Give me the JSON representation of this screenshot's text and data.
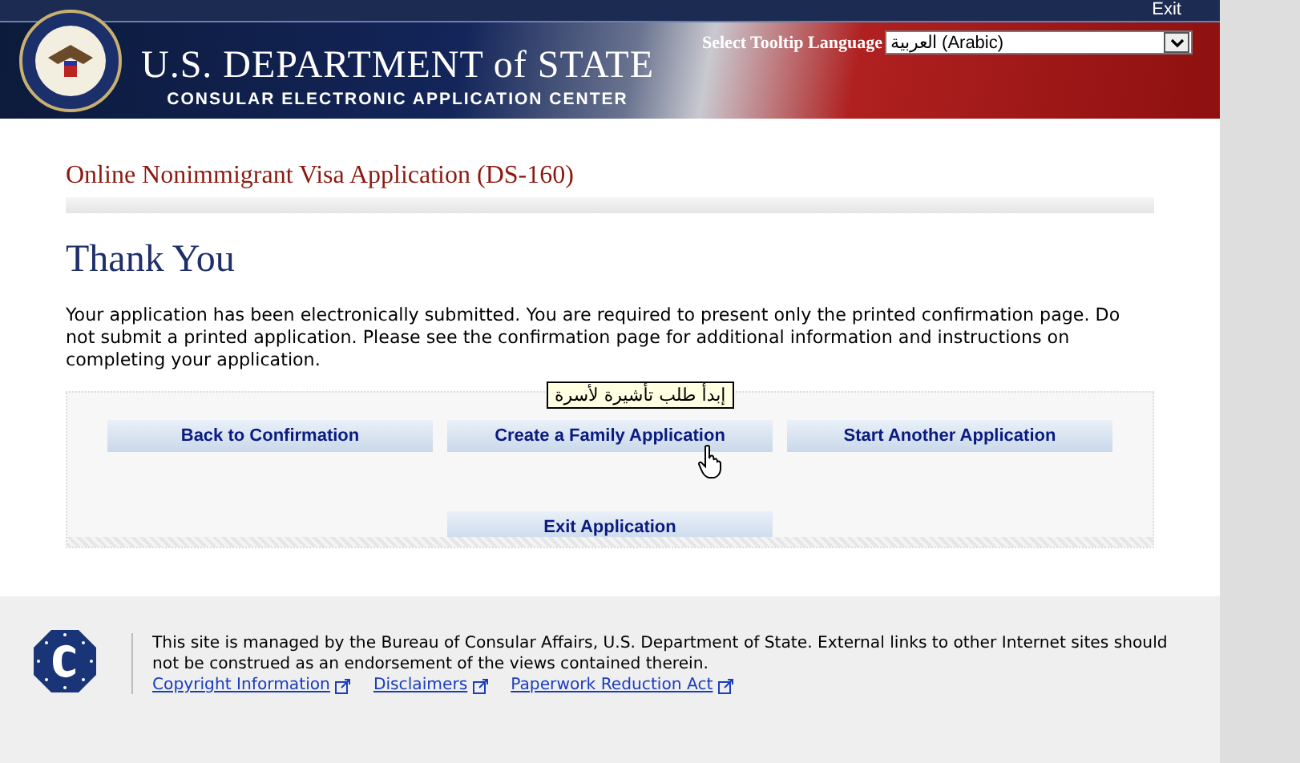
{
  "header": {
    "exit_link": "Exit",
    "title": "U.S. DEPARTMENT of STATE",
    "subtitle": "CONSULAR ELECTRONIC APPLICATION CENTER",
    "language_label": "Select Tooltip Language",
    "language_value": "العربية (Arabic)"
  },
  "page_title": "Online Nonimmigrant Visa Application (DS-160)",
  "heading": "Thank You",
  "message": "Your application has been electronically submitted. You are required to present only the printed confirmation page. Do not submit a printed application. Please see the confirmation page for additional information and instructions on completing your application.",
  "tooltip": "إبدأ طلب تأشيرة لأسرة",
  "button_rows": [
    [
      "Back to Confirmation",
      "Create a Family Application",
      "Start Another Application"
    ],
    [
      "Exit Application"
    ]
  ],
  "footer": {
    "text": "This site is managed by the Bureau of Consular Affairs, U.S. Department of State. External links to other Internet sites should not be construed as an endorsement of the views contained therein.",
    "links": [
      "Copyright Information",
      "Disclaimers",
      "Paperwork Reduction Act"
    ]
  }
}
